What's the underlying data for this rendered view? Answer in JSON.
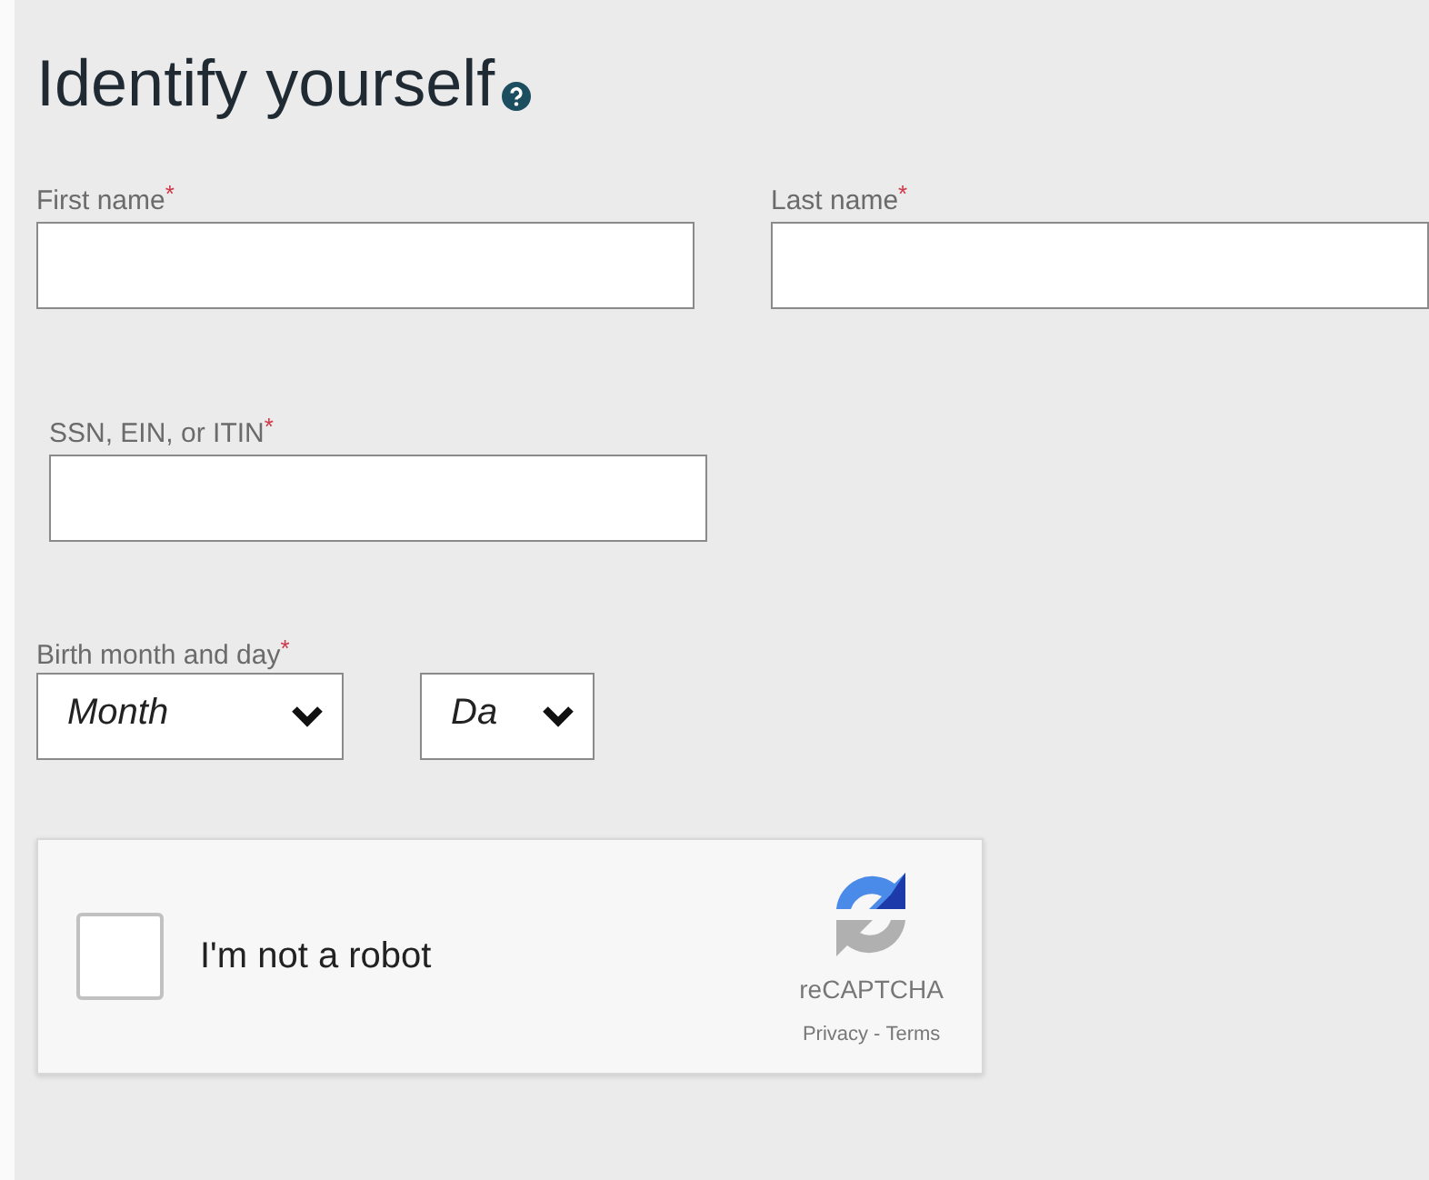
{
  "heading": "Identify yourself",
  "fields": [
    {
      "label": "First name",
      "mark": "*"
    },
    {
      "label": "Last name",
      "mark": "*"
    },
    {
      "label": "SSN, EIN, or ITIN",
      "mark": "*"
    }
  ],
  "birth": {
    "label": "Birth month and day",
    "mark": "*",
    "selects": [
      {
        "value": "Month"
      },
      {
        "value": "Da"
      }
    ]
  },
  "captcha": {
    "label": "I'm not a robot",
    "checked": false,
    "brand": "reCAPTCHA",
    "links": [
      "Privacy",
      "Terms"
    ],
    "separator": "-"
  }
}
